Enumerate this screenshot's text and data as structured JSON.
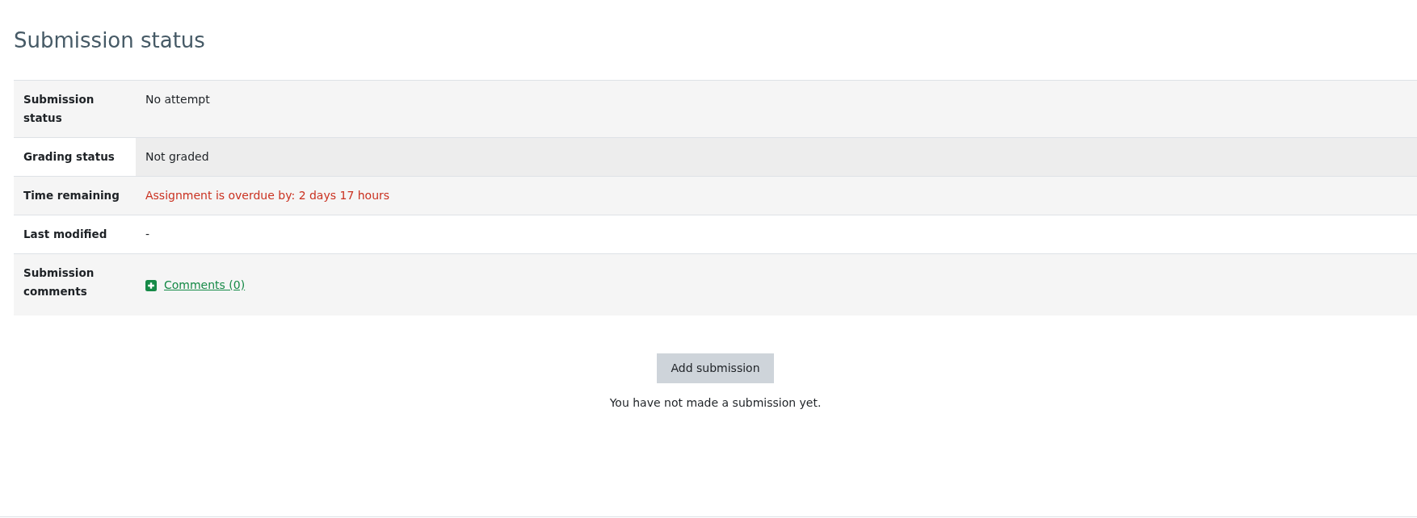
{
  "heading": "Submission status",
  "table": {
    "rows": [
      {
        "label": "Submission status",
        "value": "No attempt",
        "kind": "text",
        "hovered": false
      },
      {
        "label": "Grading status",
        "value": "Not graded",
        "kind": "text",
        "hovered": true
      },
      {
        "label": "Time remaining",
        "value": "Assignment is overdue by: 2 days 17 hours",
        "kind": "overdue",
        "hovered": false
      },
      {
        "label": "Last modified",
        "value": "-",
        "kind": "text",
        "hovered": false
      },
      {
        "label": "Submission comments",
        "value": "Comments (0)",
        "kind": "link",
        "hovered": false
      }
    ]
  },
  "button": "Add submission",
  "note": "You have not made a submission yet."
}
